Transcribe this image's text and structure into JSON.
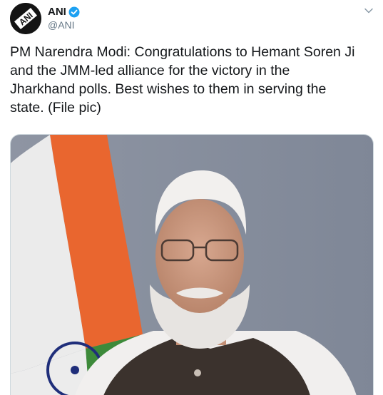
{
  "account": {
    "display_name": "ANI",
    "handle": "@ANI",
    "verified": true,
    "avatar_icon": "ani-logo-icon",
    "avatar_text": "ANI"
  },
  "menu": {
    "icon": "chevron-down-icon"
  },
  "tweet": {
    "lines": [
      "PM Narendra Modi: Congratulations to Hemant Soren Ji",
      "and the JMM-led alliance for the victory in the",
      "Jharkhand polls. Best wishes to them in serving the",
      "state. (File pic)"
    ]
  },
  "media": {
    "type": "photo",
    "icon": "photo-image"
  },
  "colors": {
    "text": "#14171a",
    "handle": "#657786",
    "verified_badge": "#1da1f2",
    "border": "#cfd9de"
  }
}
